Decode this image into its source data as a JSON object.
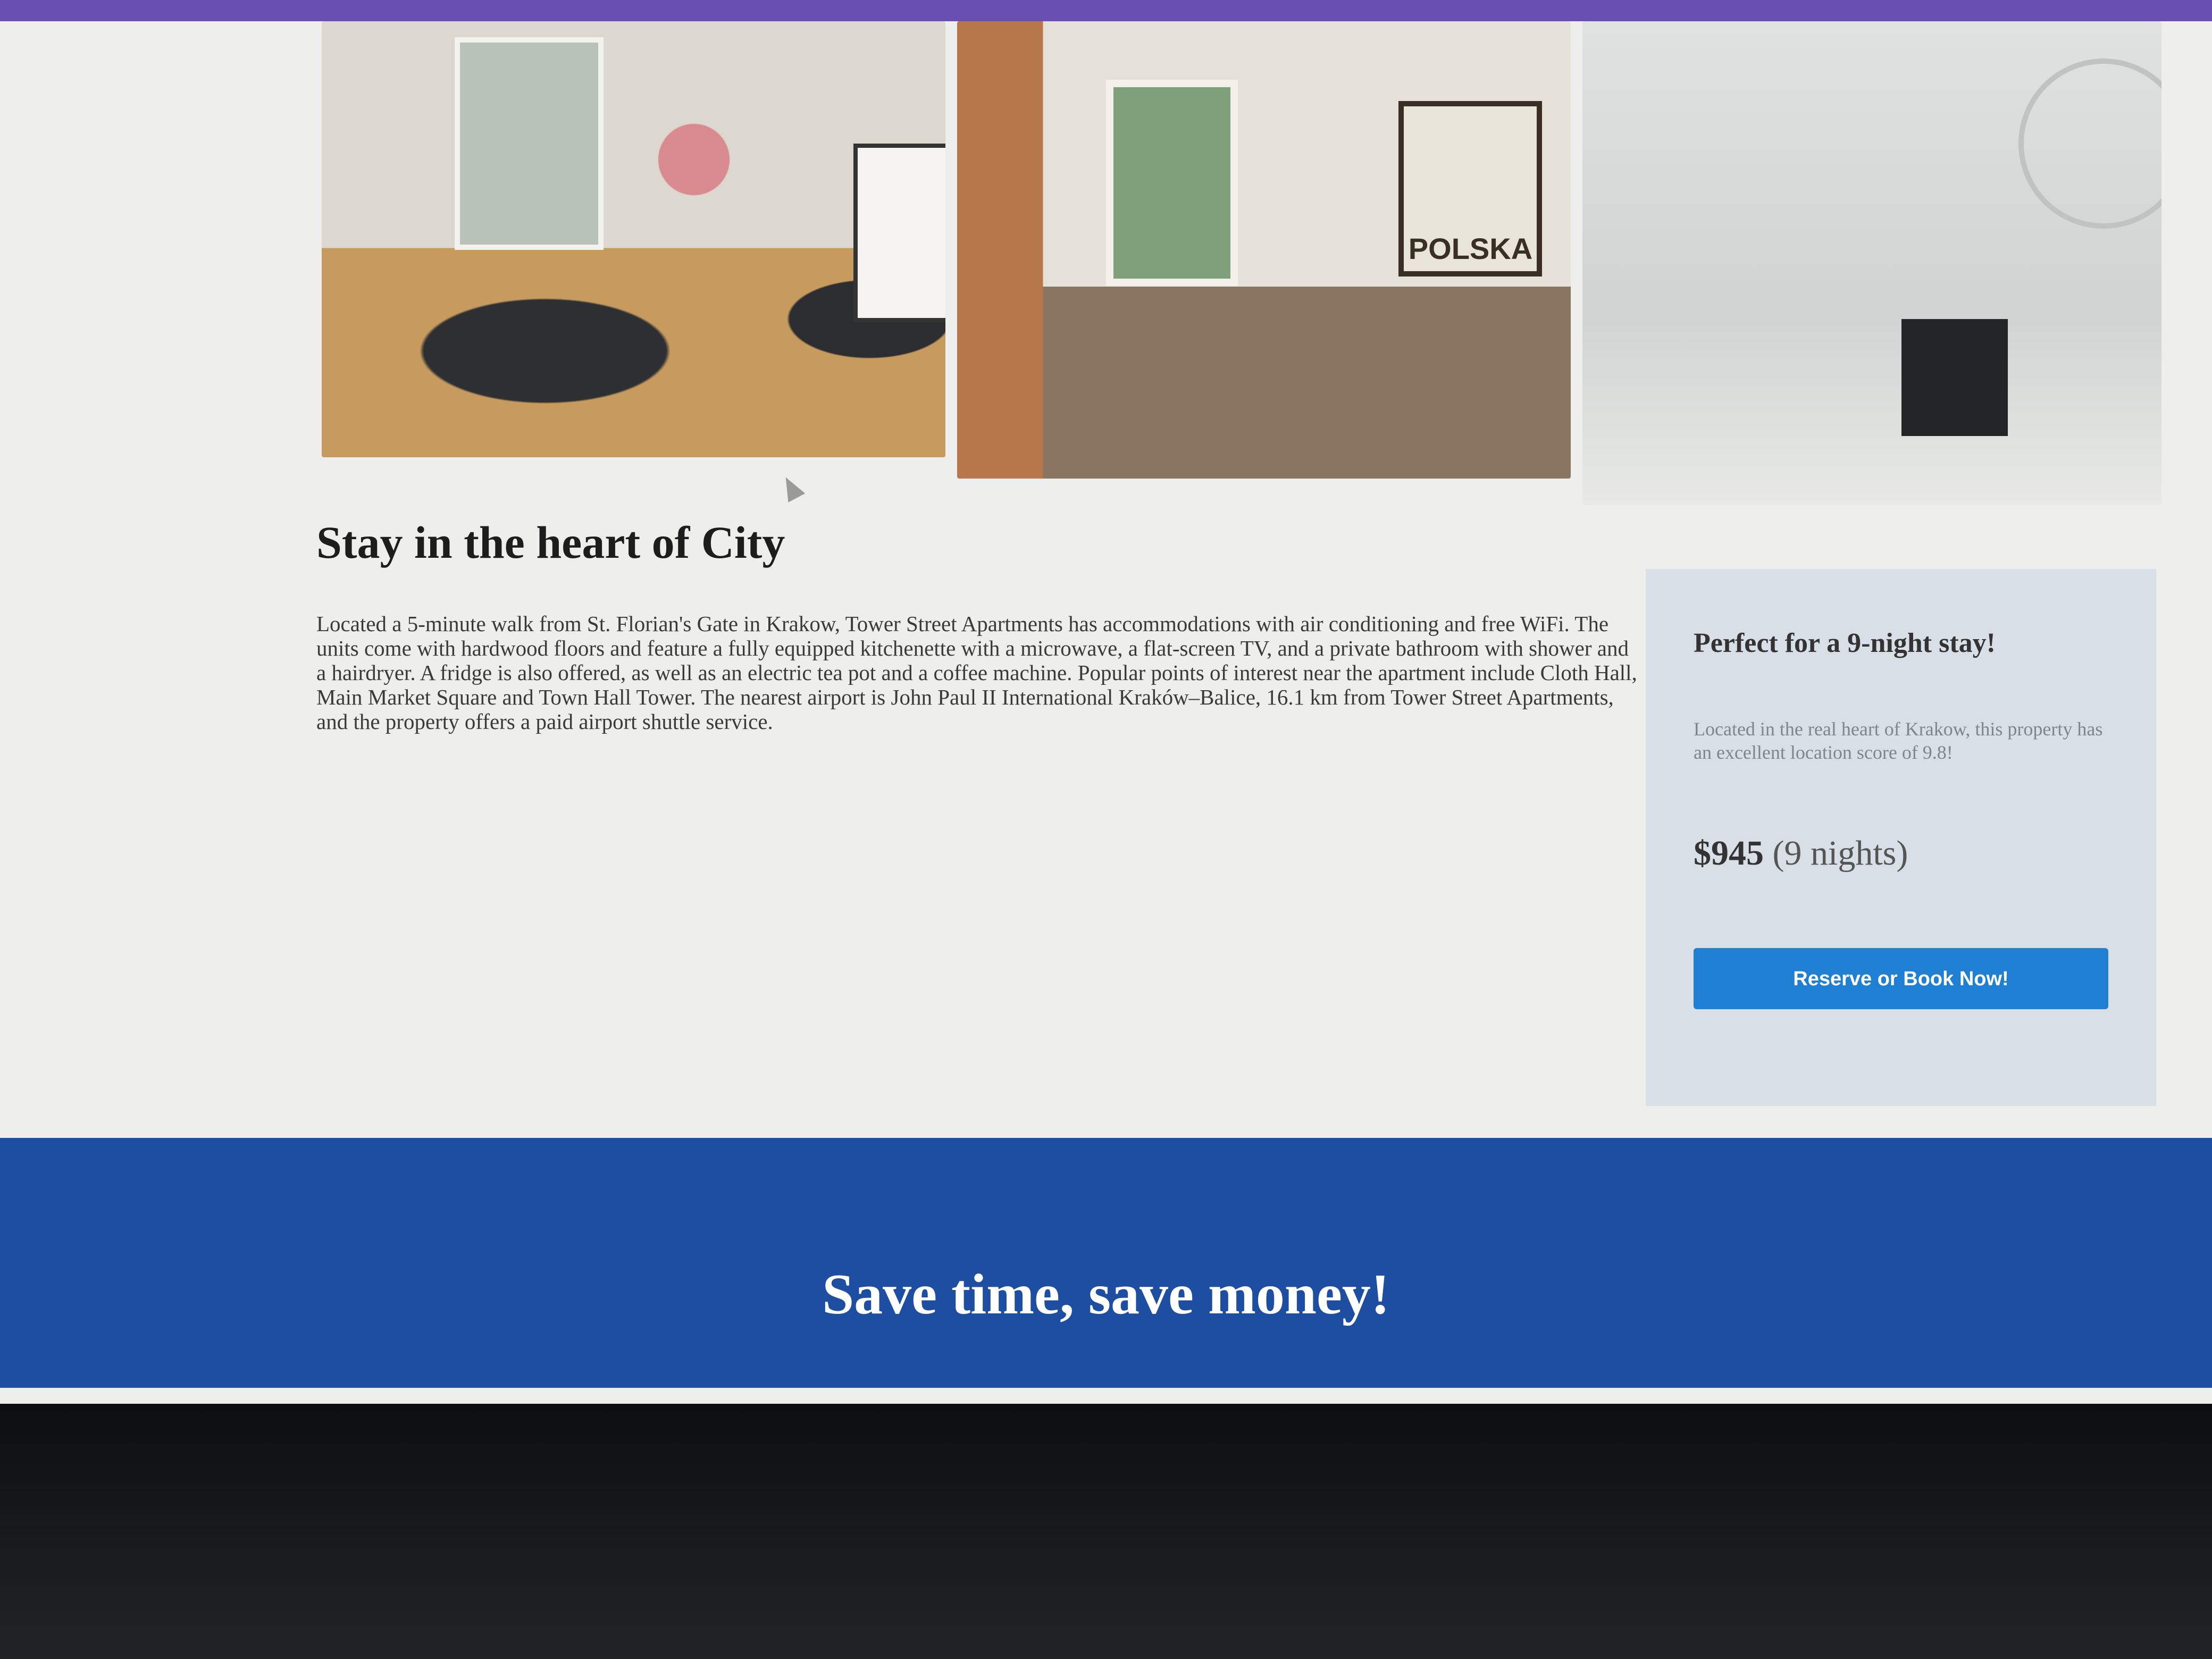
{
  "gallery": {
    "photos": [
      {
        "name": "dining-table-photo"
      },
      {
        "name": "living-room-photo",
        "poster_text": "POLSKA"
      },
      {
        "name": "bathroom-photo"
      }
    ]
  },
  "main": {
    "title": "Stay in the heart of City",
    "description": "Located a 5-minute walk from St. Florian's Gate in Krakow, Tower Street Apartments has accommodations with air conditioning and free WiFi. The units come with hardwood floors and feature a fully equipped kitchenette with a microwave, a flat-screen TV, and a private bathroom with shower and a hairdryer. A fridge is also offered, as well as an electric tea pot and a coffee machine. Popular points of interest near the apartment include Cloth Hall, Main Market Square and Town Hall Tower. The nearest airport is John Paul II International Kraków–Balice, 16.1 km from Tower Street Apartments, and the property offers a paid airport shuttle service."
  },
  "booking_card": {
    "title": "Perfect for a 9-night stay!",
    "text": "Located in the real heart of Krakow, this property has an excellent location score of 9.8!",
    "price": "$945",
    "nights": "(9 nights)",
    "button_label": "Reserve or Book Now!",
    "button_color": "#1e7fd3",
    "card_color": "#d8dfe6"
  },
  "banner": {
    "text": "Save time, save money!",
    "color": "#1d4ea1"
  },
  "colors": {
    "top_edge": "#6a4fb3",
    "page_bg": "#eeefec"
  }
}
